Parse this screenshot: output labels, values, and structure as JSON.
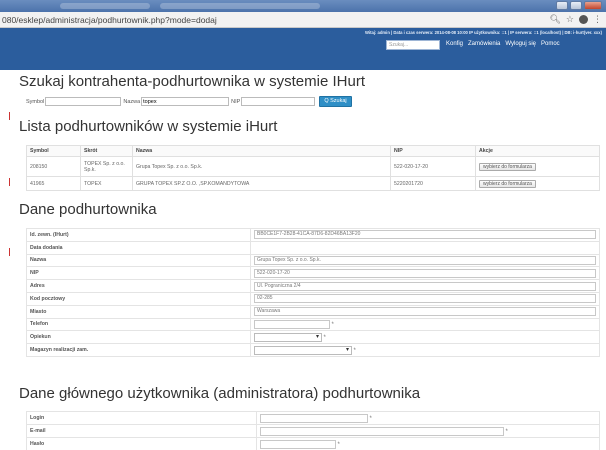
{
  "browser": {
    "url": "080/esklep/administracja/podhurtownik.php?mode=dodaj"
  },
  "appbar": {
    "login_info": "Witaj: admin | Data i czas serwera: 2014-08-08 10:00 IP użytkownika: ::1 | IP serwera: ::1 (localhost) | DB: i-hurt(ver. xxx)",
    "search_placeholder": "Szukaj...",
    "nav": [
      "Konfig",
      "Zamówienia",
      "Wyloguj się",
      "Pomoc"
    ]
  },
  "search_section": {
    "title": "Szukaj kontrahenta-podhurtownika w systemie IHurt",
    "symbol_label": "Symbol",
    "symbol_value": "",
    "nazwa_label": "Nazwa",
    "nazwa_value": "topex",
    "nip_label": "NIP",
    "nip_value": "",
    "search_button": "Q Szukaj"
  },
  "list_section": {
    "title": "Lista podhurtowników w systemie iHurt",
    "headers": [
      "Symbol",
      "Skrót",
      "Nazwa",
      "NIP",
      "Akcje"
    ],
    "rows": [
      {
        "symbol": "208150",
        "skrot": "TOPEX Sp. z o.o. Sp.k.",
        "nazwa": "Grupa Topex Sp. z o.o. Sp.k.",
        "nip": "522-020-17-20",
        "akcja": "wybierz do formularza"
      },
      {
        "symbol": "41965",
        "skrot": "TOPEX",
        "nazwa": "GRUPA TOPEX SP.Z O.O. ,SP.KOMANDYTOWA",
        "nip": "5220201720",
        "akcja": "wybierz do formularza"
      }
    ]
  },
  "details_section": {
    "title": "Dane podhurtownika",
    "fields": [
      {
        "label": "Id. zewn. (IHurt)",
        "value": "BB0CE1F7-2B28-41CA-87D6-82D46BA13F20"
      },
      {
        "label": "Data dodania",
        "value": ""
      },
      {
        "label": "Nazwa",
        "value": "Grupa Topex Sp. z o.o. Sp.k."
      },
      {
        "label": "NIP",
        "value": "522-020-17-20"
      },
      {
        "label": "Adres",
        "value": "Ul. Pograniczna 2/4"
      },
      {
        "label": "Kod pocztowy",
        "value": "02-285"
      },
      {
        "label": "Miasto",
        "value": "Warszawa"
      },
      {
        "label": "Telefon",
        "value": "",
        "required": "*"
      },
      {
        "label": "Opiekun",
        "value": "",
        "required": "*"
      },
      {
        "label": "Magazyn realizacji zam.",
        "value": "",
        "required": "*"
      }
    ]
  },
  "admin_section": {
    "title": "Dane głównego użytkownika (administratora) podhurtownika",
    "fields": [
      {
        "label": "Login",
        "required": "*"
      },
      {
        "label": "E-mail",
        "required": "*"
      },
      {
        "label": "Hasło",
        "required": "*"
      }
    ]
  }
}
